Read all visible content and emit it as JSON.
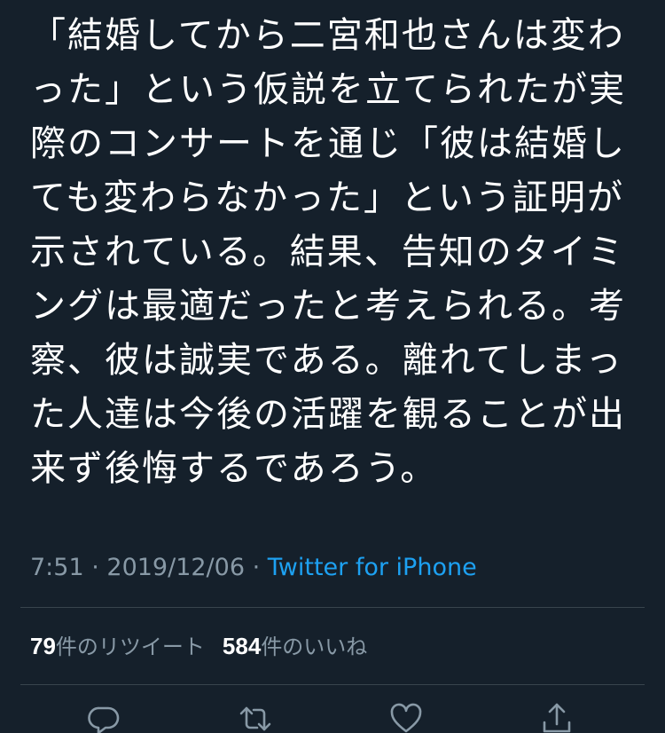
{
  "tweet": {
    "text": "「結婚してから二宮和也さんは変わった」という仮説を立てられたが実際のコンサートを通じ「彼は結婚しても変わらなかった」という証明が示されている。結果、告知のタイミングは最適だったと考えられる。考察、彼は誠実である。離れてしまった人達は今後の活躍を観ることが出来ず後悔するであろう。",
    "time": "7:51",
    "separator": " · ",
    "date": "2019/12/06",
    "source": "Twitter for iPhone"
  },
  "stats": {
    "retweets_count": "79",
    "retweets_label": "件のリツイート",
    "likes_count": "584",
    "likes_label": "件のいいね"
  },
  "actions": {
    "reply_icon": "reply-icon",
    "retweet_icon": "retweet-icon",
    "like_icon": "heart-icon",
    "share_icon": "share-icon"
  },
  "colors": {
    "background": "#15202b",
    "text": "#ffffff",
    "secondary": "#8899a6",
    "link": "#1da1f2",
    "divider": "#38444d"
  }
}
